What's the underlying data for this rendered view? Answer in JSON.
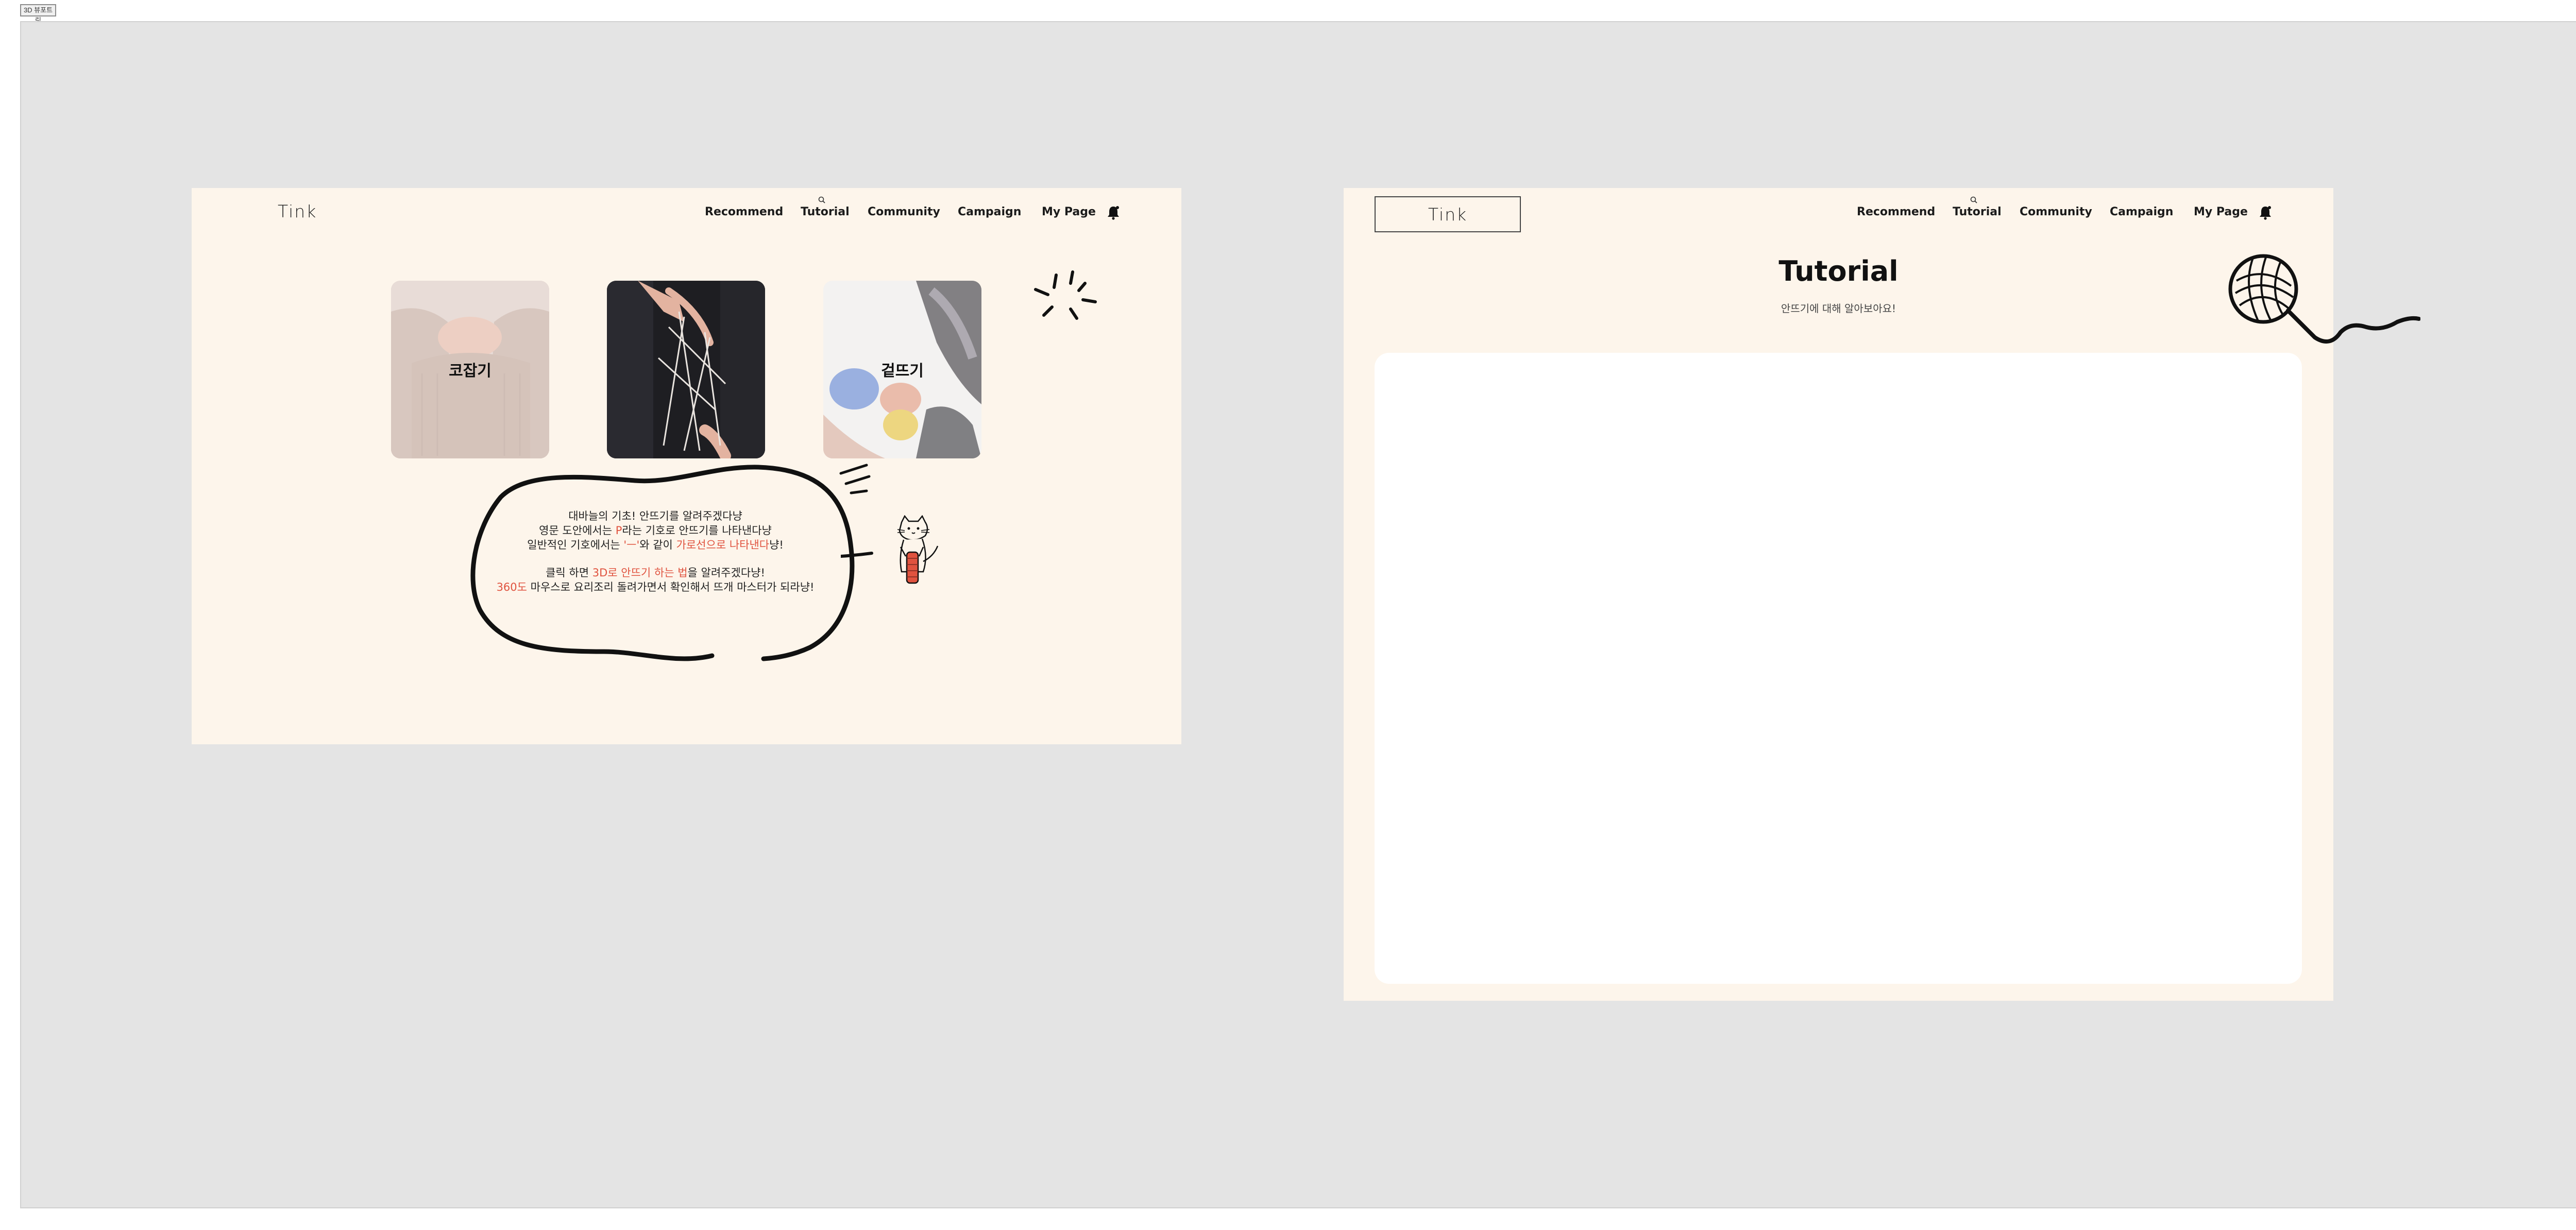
{
  "toolbar": {
    "button_label": "3D 뷰포트링"
  },
  "frame1": {
    "logo": "Tink",
    "nav": [
      "Recommend",
      "Tutorial",
      "Community",
      "Campaign",
      "My Page"
    ],
    "cards": [
      {
        "label": "코잡기"
      },
      {
        "label": ""
      },
      {
        "label": "겉뜨기"
      }
    ],
    "speech": {
      "line1": "대바늘의 기초! 안뜨기를 알려주겠다냥",
      "line2_a": "영문 도안에서는 ",
      "line2_b": "P",
      "line2_c": "라는 기호로 안뜨기를 나타낸다냥",
      "line3_a": "일반적인 기호에서는 ",
      "line3_b": "'ㅡ'",
      "line3_c": "와 같이 ",
      "line3_d": "가로선으로 나타낸다",
      "line3_e": "냥!",
      "line4_a": "클릭 하면 ",
      "line4_b": "3D로 안뜨기 하는 법",
      "line4_c": "을 알려주겠다냥!",
      "line5_a": "360도",
      "line5_b": " 마우스로 요리조리 돌려가면서 확인해서 뜨개 마스터가 되라냥!"
    }
  },
  "frame2": {
    "logo": "Tink",
    "nav": [
      "Recommend",
      "Tutorial",
      "Community",
      "Campaign",
      "My Page"
    ],
    "title": "Tutorial",
    "subtitle": "안뜨기에 대해 알아보아요!"
  },
  "colors": {
    "canvas_bg": "#e4e4e4",
    "frame_bg": "#fdf5eb",
    "highlight": "#e0533f",
    "text": "#1b1b1b"
  }
}
